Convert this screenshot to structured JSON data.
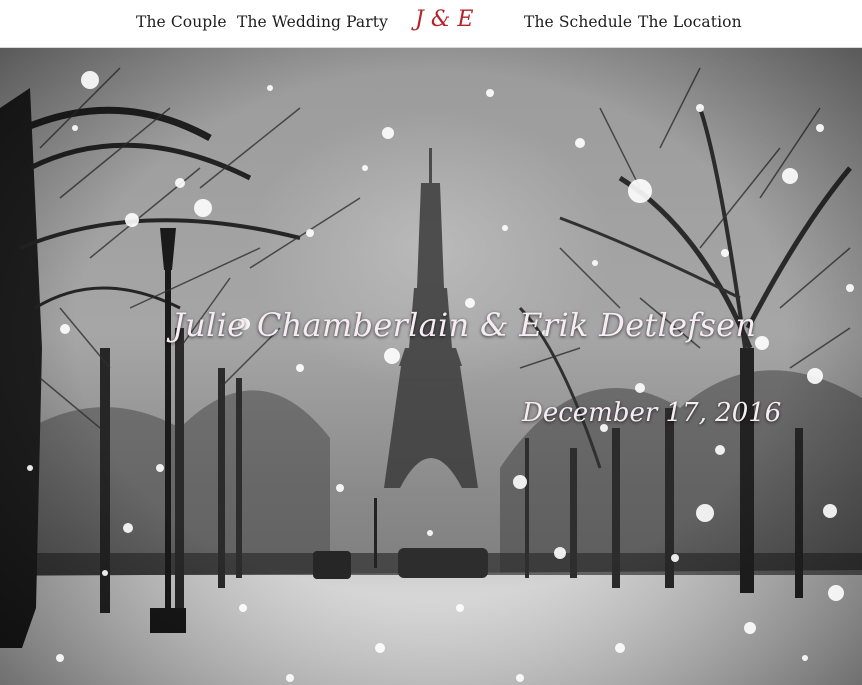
{
  "nav": {
    "items": [
      {
        "label": "The Couple"
      },
      {
        "label": "The Wedding Party"
      },
      {
        "label": "The Schedule"
      },
      {
        "label": "The Location"
      }
    ],
    "logo": "J & E"
  },
  "hero": {
    "names": "Julie Chamberlain & Erik Detlefsen",
    "date": "December 17, 2016"
  },
  "colors": {
    "logo": "#b3232a",
    "hero_text": "#f6ecf2",
    "nav_text": "#1d1d1d"
  }
}
